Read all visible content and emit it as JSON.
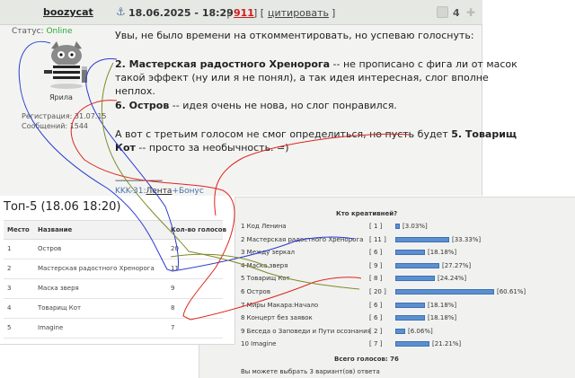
{
  "post": {
    "author": "boozycat",
    "date": "18.06.2025 - 18:29",
    "post_number": "911",
    "quote_label": "цитировать",
    "rating": "4",
    "status_label": "Статус:",
    "status_value": "Online",
    "avatar_caption": "Ярила",
    "registration": "Регистрация: 31.07.15",
    "messages": "Сообщений: 1544",
    "lines": [
      "Увы, не было времени на откомментировать, но успеваю голоснуть:",
      "2. Мастерская радостного Хренорога",
      " -- не прописано с фига ли от масок",
      "такой эффект (ну или я не понял), а так идея интересная, слог вполне",
      "неплох.",
      "6. Остров",
      " -- идея очень не нова, но слог понравился.",
      "А вот с третьим голосом не смог определиться, но пусть будет ",
      "5. Товарищ",
      "Кот",
      " -- просто за необычность. =)"
    ],
    "separator": "--------------------",
    "signature_prefix": "KKK-31:",
    "signature_link": "Лента",
    "signature_suffix": "+Бонус"
  },
  "top5": {
    "title": "Топ-5 (18.06 18:20)",
    "headers": [
      "Место",
      "Название",
      "Кол-во голосов"
    ],
    "rows": [
      [
        "1",
        "Остров",
        "20"
      ],
      [
        "2",
        "Мастерская радостного Хренорога",
        "11"
      ],
      [
        "3",
        "Маска зверя",
        "9"
      ],
      [
        "4",
        "Товарищ Кот",
        "8"
      ],
      [
        "5",
        "Imagine",
        "7"
      ]
    ]
  },
  "poll": {
    "question": "Кто креативней?",
    "options": [
      {
        "label": "1 Код Ленина",
        "count": "[ 1 ]",
        "percent": 3.03,
        "percent_text": "[3.03%]"
      },
      {
        "label": "2 Мастерская радостного Хренорога",
        "count": "[ 11 ]",
        "percent": 33.33,
        "percent_text": "[33.33%]"
      },
      {
        "label": "3 Между зеркал",
        "count": "[ 6 ]",
        "percent": 18.18,
        "percent_text": "[18.18%]"
      },
      {
        "label": "4 Маска зверя",
        "count": "[ 9 ]",
        "percent": 27.27,
        "percent_text": "[27.27%]"
      },
      {
        "label": "5 Товарищ Кот",
        "count": "[ 8 ]",
        "percent": 24.24,
        "percent_text": "[24.24%]"
      },
      {
        "label": "6 Остров",
        "count": "[ 20 ]",
        "percent": 60.61,
        "percent_text": "[60.61%]"
      },
      {
        "label": "7 Миры Макара:Начало",
        "count": "[ 6 ]",
        "percent": 18.18,
        "percent_text": "[18.18%]"
      },
      {
        "label": "8 Концерт без заявок",
        "count": "[ 6 ]",
        "percent": 18.18,
        "percent_text": "[18.18%]"
      },
      {
        "label": "9 Беседа о Заповеди и Пути осознания",
        "count": "[ 2 ]",
        "percent": 6.06,
        "percent_text": "[6.06%]"
      },
      {
        "label": "10 Imagine",
        "count": "[ 7 ]",
        "percent": 21.21,
        "percent_text": "[21.21%]"
      }
    ],
    "total": "Всего голосов: 76",
    "note": "Вы можете выбрать 3 вариант(ов) ответа"
  },
  "colors": {
    "online": "#2aa830",
    "post_number": "#cc1c1c",
    "bar": "#5b8fd0",
    "scribble_red": "#e0231c",
    "scribble_blue": "#2a3ad0",
    "scribble_olive": "#7e8a2a"
  }
}
